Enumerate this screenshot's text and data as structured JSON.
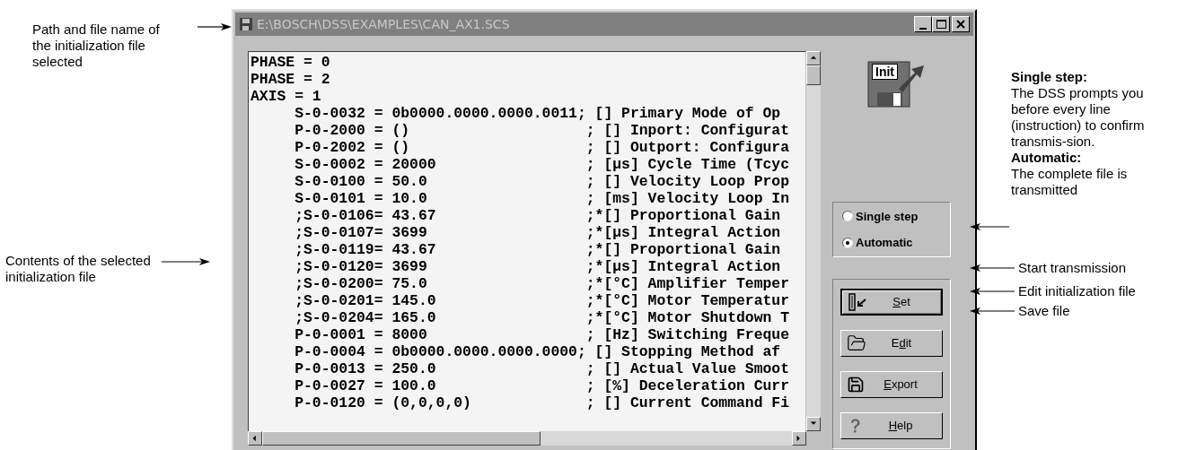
{
  "window": {
    "title": "E:\\BOSCH\\DSS\\EXAMPLES\\CAN_AX1.SCS"
  },
  "file_lines": [
    "PHASE = 0",
    "PHASE = 2",
    "AXIS = 1",
    "     S-0-0032 = 0b0000.0000.0000.0011; [] Primary Mode of Op",
    "     P-0-2000 = ()                    ; [] Inport: Configurat",
    "     P-0-2002 = ()                    ; [] Outport: Configura",
    "     S-0-0002 = 20000                 ; [µs] Cycle Time (Tcyc",
    "     S-0-0100 = 50.0                  ; [] Velocity Loop Prop",
    "     S-0-0101 = 10.0                  ; [ms] Velocity Loop In",
    "     ;S-0-0106= 43.67                 ;*[] Proportional Gain",
    "     ;S-0-0107= 3699                  ;*[µs] Integral Action",
    "     ;S-0-0119= 43.67                 ;*[] Proportional Gain",
    "     ;S-0-0120= 3699                  ;*[µs] Integral Action",
    "     ;S-0-0200= 75.0                  ;*[°C] Amplifier Temper",
    "     ;S-0-0201= 145.0                 ;*[°C] Motor Temperatur",
    "     ;S-0-0204= 165.0                 ;*[°C] Motor Shutdown T",
    "     P-0-0001 = 8000                  ; [Hz] Switching Freque",
    "     P-0-0004 = 0b0000.0000.0000.0000; [] Stopping Method af",
    "     P-0-0013 = 250.0                 ; [] Actual Value Smoot",
    "     P-0-0027 = 100.0                 ; [%] Deceleration Curr",
    "     P-0-0120 = (0,0,0,0)             ; [] Current Command Fi"
  ],
  "icon_label": "Init",
  "mode_options": [
    {
      "label": "Single step",
      "selected": false
    },
    {
      "label": "Automatic",
      "selected": true
    }
  ],
  "buttons": [
    {
      "kind": "set",
      "key": "S",
      "post": "et",
      "default": true
    },
    {
      "kind": "edit",
      "pre": "E",
      "key": "d",
      "post": "it",
      "default": false
    },
    {
      "kind": "export",
      "key": "E",
      "post": "xport",
      "default": false
    },
    {
      "kind": "help",
      "key": "H",
      "post": "elp",
      "default": false
    }
  ],
  "left_notes": [
    "Path and file name of the initialization file selected",
    "Contents of the selected initialization file"
  ],
  "right_notes": {
    "modes": [
      {
        "heading": "Single step:",
        "body": "The DSS prompts you before every line (instruction) to confirm transmis-sion."
      },
      {
        "heading": "Automatic:",
        "body": "The complete file is transmitted"
      }
    ],
    "set": "Start transmission",
    "edit": "Edit initialization file",
    "export": "Save file"
  }
}
